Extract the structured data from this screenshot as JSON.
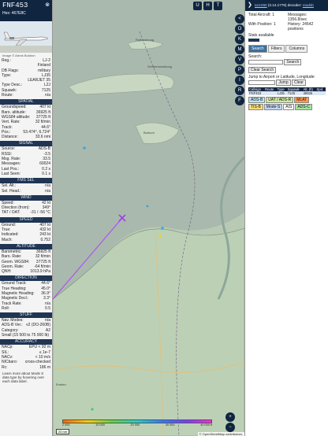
{
  "aircraft": {
    "callsign": "FNF453",
    "hex_line": "Hex: 467E8C",
    "photo_credit": "Image © Alexis Boidron"
  },
  "details": [
    {
      "k": "Reg.:",
      "v": "LJ-2"
    },
    {
      "k": "",
      "v": "Finland"
    },
    {
      "k": "DB Flags:",
      "v": "military"
    },
    {
      "k": "Type:",
      "v": "LJ35"
    },
    {
      "k": "",
      "v": "LEARJET 35"
    },
    {
      "k": "Type Desc.:",
      "v": "L2J"
    },
    {
      "k": "Squawk:",
      "v": "7125"
    },
    {
      "k": "Route:",
      "v": "n/a"
    }
  ],
  "sections": [
    {
      "title": "SPATIAL",
      "rows": [
        {
          "k": "Groundspeed:",
          "v": "407 kt"
        },
        {
          "k": "Baro. altitude:",
          "v": "36925 ft"
        },
        {
          "k": "WGS84 altitude:",
          "v": "37725 ft"
        },
        {
          "k": "Vert. Rate:",
          "v": "32 ft/min"
        },
        {
          "k": "Track:",
          "v": "44.6°"
        },
        {
          "k": "Pos.:",
          "v": "53.474°, 6.724°"
        },
        {
          "k": "Distance:",
          "v": "33.6 nmi"
        }
      ]
    },
    {
      "title": "SIGNAL",
      "rows": [
        {
          "k": "Source:",
          "v": "ADS-B"
        },
        {
          "k": "RSSI:",
          "v": "-3.5"
        },
        {
          "k": "Msg. Rate:",
          "v": "33.5"
        },
        {
          "k": "Messages:",
          "v": "60024"
        },
        {
          "k": "Last Pos.:",
          "v": "0.2 s"
        },
        {
          "k": "Last Seen:",
          "v": "0.1 s"
        }
      ]
    },
    {
      "title": "FMS SEL",
      "rows": [
        {
          "k": "Sel. Alt.:",
          "v": "n/a"
        },
        {
          "k": "Sel. Head.:",
          "v": "n/a"
        }
      ]
    },
    {
      "title": "WIND",
      "rows": [
        {
          "k": "Speed:",
          "v": "42 kt"
        },
        {
          "k": "Direction (from):",
          "v": "349°"
        },
        {
          "k": "TAT / OAT:",
          "v": "-31 / -56 °C"
        }
      ]
    },
    {
      "title": "SPEED",
      "rows": [
        {
          "k": "Ground:",
          "v": "407 kt"
        },
        {
          "k": "True:",
          "v": "432 kt"
        },
        {
          "k": "Indicated:",
          "v": "243 kt"
        },
        {
          "k": "Mach:",
          "v": "0.752"
        }
      ]
    },
    {
      "title": "ALTITUDE",
      "rows": [
        {
          "k": "Barometric:",
          "v": "36925 ft"
        },
        {
          "k": "Baro. Rate:",
          "v": "32 ft/min"
        },
        {
          "k": "Geom. WGS84:",
          "v": "37725 ft"
        },
        {
          "k": "Geom. Rate:",
          "v": "-64 ft/min"
        },
        {
          "k": "QNH:",
          "v": "1013.9 hPa"
        }
      ]
    },
    {
      "title": "DIRECTION",
      "rows": [
        {
          "k": "Ground Track:",
          "v": "44.6°"
        },
        {
          "k": "True Heading:",
          "v": "45.0°"
        },
        {
          "k": "Magnetic Heading:",
          "v": "36.9°"
        },
        {
          "k": "Magnetic Decl.:",
          "v": "3.3°"
        },
        {
          "k": "Track Rate:",
          "v": "n/a"
        },
        {
          "k": "Roll:",
          "v": "0.5"
        }
      ]
    },
    {
      "title": "STUFF",
      "rows": [
        {
          "k": "Nav. Modes:",
          "v": "n/a"
        },
        {
          "k": "ADS-B Ver.:",
          "v": "v2 (DO-260B)"
        },
        {
          "k": "Category:",
          "v": "A2"
        },
        {
          "k": "Small (15 500 to 75 000 lb)",
          "v": ""
        }
      ]
    },
    {
      "title": "ACCURACY",
      "rows": [
        {
          "k": "NACp:",
          "v": "EPU < 92 m"
        },
        {
          "k": "SIL:",
          "v": "≤ 1e-7"
        },
        {
          "k": "NACv:",
          "v": "< 10 m/s"
        },
        {
          "k": "NICbaro:",
          "v": "cross-checked"
        },
        {
          "k": "Rc:",
          "v": "186 m"
        }
      ]
    }
  ],
  "footer_note": "Learn more about Mode S data type by hovering over each data label.",
  "map": {
    "top_buttons": [
      "U",
      "H",
      "T"
    ],
    "side_buttons": [
      "<",
      "O",
      "K",
      "M",
      "V",
      "P",
      "I",
      "R",
      "F"
    ],
    "place_labels": [
      "Schiermonnikoog",
      "Rottumeroog",
      "Borkum",
      "Emden"
    ],
    "zoom_in": "+",
    "zoom_out": "−",
    "scale": "20 nm",
    "attribution": "© OpenStreetMap contributors.",
    "alt_scale": [
      "2 000",
      "10 000",
      "20 000",
      "30 000",
      "40 000 ft"
    ]
  },
  "right": {
    "version_link": "tar1090",
    "version_text": "(3.14.1779) decoder:",
    "version_link2": "readsb",
    "stats": [
      {
        "k": "Total Aircraft:",
        "v": "1"
      },
      {
        "k": "Messages:",
        "v": "1356.8/sec"
      },
      {
        "k": "With Position:",
        "v": "1"
      },
      {
        "k": "History:",
        "v": "24542 positions"
      }
    ],
    "stats_available": "Stats available",
    "tabs": [
      "Search",
      "Filters",
      "Columns"
    ],
    "search_label": "Search:",
    "search_button": "Search",
    "clear_search": "Clear Search",
    "jump_label": "Jump to Airport or Latitude, Longitude:",
    "jump_button": "Jump",
    "clear_button": "Clear",
    "table_headers": [
      "Callsign",
      "Route",
      "Type",
      "Squawk",
      "Alt. (ft)",
      "Spd."
    ],
    "table_row": {
      "callsign": "FNF453",
      "route": "",
      "type": "LJ35",
      "squawk": "7125",
      "alt": "36925",
      "spd": ""
    },
    "sources": [
      {
        "label": "ADS-B",
        "color": "#b9e4f0"
      },
      {
        "label": "UAT / ADS-R",
        "color": "#cfe8a4"
      },
      {
        "label": "MLAT",
        "color": "#ff9a4d"
      },
      {
        "label": "TIS-B",
        "color": "#f6dc7a"
      },
      {
        "label": "Mode-S",
        "color": "#c2d6f5"
      },
      {
        "label": "AIS",
        "color": "#ffffff"
      },
      {
        "label": "ADS-C",
        "color": "#a6e3a0"
      }
    ]
  }
}
